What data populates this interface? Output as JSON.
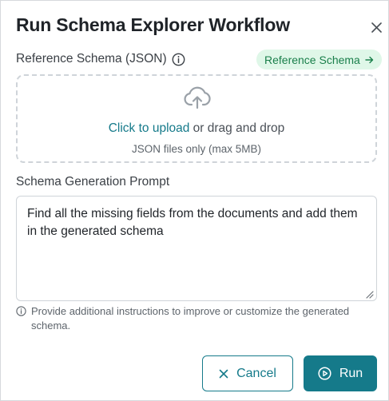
{
  "dialog": {
    "title": "Run Schema Explorer Workflow"
  },
  "reference": {
    "label": "Reference Schema (JSON)",
    "badge_label": "Reference Schema"
  },
  "dropzone": {
    "link_text": "Click to upload",
    "rest_text": " or drag and drop",
    "hint": "JSON files only (max 5MB)"
  },
  "prompt": {
    "label": "Schema Generation Prompt",
    "value": "Find all the missing fields from the documents and add them in the generated schema",
    "help": "Provide additional instructions to improve or customize the generated schema."
  },
  "actions": {
    "cancel_label": "Cancel",
    "run_label": "Run"
  },
  "colors": {
    "accent": "#157a8a",
    "badge_bg": "#dff7e8",
    "badge_text": "#1a7f4b"
  },
  "icons": [
    "close-icon",
    "info-icon",
    "arrow-right-icon",
    "cloud-upload-icon",
    "resize-grip-icon",
    "x-icon",
    "play-circle-icon"
  ]
}
